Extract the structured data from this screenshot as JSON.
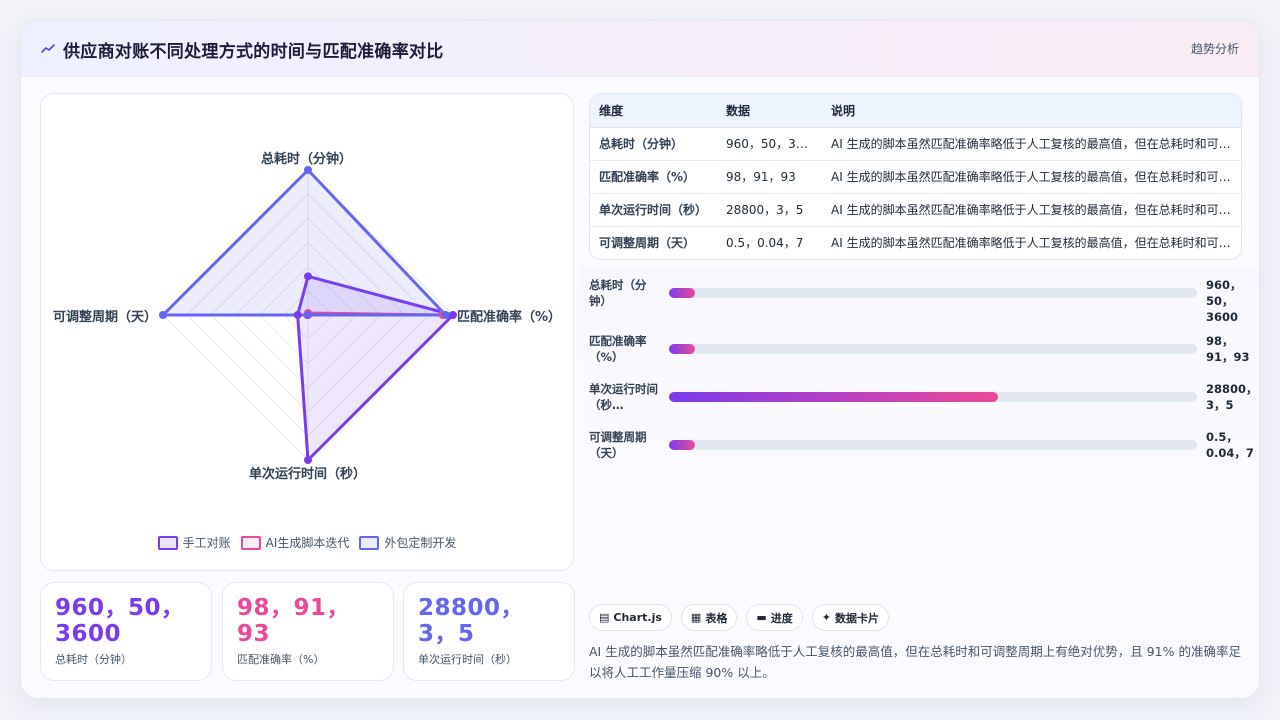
{
  "header": {
    "icon": "trend-line-icon",
    "title": "供应商对账不同处理方式的时间与匹配准确率对比",
    "tag": "趋势分析"
  },
  "colors": {
    "primary": "#7c3aed",
    "accent": "#ec4899",
    "tertiary": "#6366f1"
  },
  "chart_data": {
    "type": "radar",
    "axes": [
      "总耗时（分钟）",
      "匹配准确率（%）",
      "单次运行时间（秒）",
      "可调整周期（天）"
    ],
    "series": [
      {
        "name": "手工对账",
        "values": [
          960,
          98,
          28800,
          0.5
        ],
        "color": "#7c3aed"
      },
      {
        "name": "AI生成脚本迭代",
        "values": [
          50,
          91,
          3,
          0.04
        ],
        "color": "#ec4899"
      },
      {
        "name": "外包定制开发",
        "values": [
          3600,
          93,
          5,
          7
        ],
        "color": "#6366f1"
      }
    ],
    "grid_levels": 6,
    "legend_position": "bottom"
  },
  "stats": [
    {
      "value": "960，50，3600",
      "label": "总耗时（分钟）",
      "color": "#7c3aed"
    },
    {
      "value": "98，91，93",
      "label": "匹配准确率（%）",
      "color": "#ec4899"
    },
    {
      "value": "28800，3，5",
      "label": "单次运行时间（秒）",
      "color": "#6366f1"
    }
  ],
  "table": {
    "headers": [
      "维度",
      "数据",
      "说明"
    ],
    "rows": [
      [
        "总耗时（分钟）",
        "960，50，3600",
        "AI 生成的脚本虽然匹配准确率略低于人工复核的最高值，但在总耗时和可调整周期上有绝对优势，且 91% 的准确率足以将人工工作量压缩 90% 以上。"
      ],
      [
        "匹配准确率（%）",
        "98，91，93",
        "AI 生成的脚本虽然匹配准确率略低于人工复核的最高值，但在总耗时和可调整周期上有绝对优势，且 91% 的准确率足以将人工工作量压缩 90% 以上。"
      ],
      [
        "单次运行时间（秒）",
        "28800，3，5",
        "AI 生成的脚本虽然匹配准确率略低于人工复核的最高值，但在总耗时和可调整周期上有绝对优势，且 91% 的准确率足以将人工工作量压缩 90% 以上。"
      ],
      [
        "可调整周期（天）",
        "0.5，0.04，7",
        "AI 生成的脚本虽然匹配准确率略低于人工复核的最高值，但在总耗时和可调整周期上有绝对优势，且 91% 的准确率足以将人工工作量压缩 90% 以上。"
      ]
    ]
  },
  "progress": [
    {
      "label": "总耗时（分钟）",
      "value": "960，50，3600",
      "fill": 0.05
    },
    {
      "label": "匹配准确率（%）",
      "value": "98，91，93",
      "fill": 0.05
    },
    {
      "label": "单次运行时间（秒…",
      "value": "28800，3，5",
      "fill": 0.624
    },
    {
      "label": "可调整周期（天）",
      "value": "0.5，0.04，7",
      "fill": 0.05
    }
  ],
  "chips": [
    {
      "icon": "chart-icon",
      "glyph": "▤",
      "label": "Chart.js"
    },
    {
      "icon": "table-icon",
      "glyph": "▦",
      "label": "表格"
    },
    {
      "icon": "progress-icon",
      "glyph": "▬",
      "label": "进度"
    },
    {
      "icon": "sparkle-icon",
      "glyph": "✦",
      "label": "数据卡片"
    }
  ],
  "summary": "AI 生成的脚本虽然匹配准确率略低于人工复核的最高值，但在总耗时和可调整周期上有绝对优势，且 91% 的准确率足以将人工工作量压缩 90% 以上。"
}
